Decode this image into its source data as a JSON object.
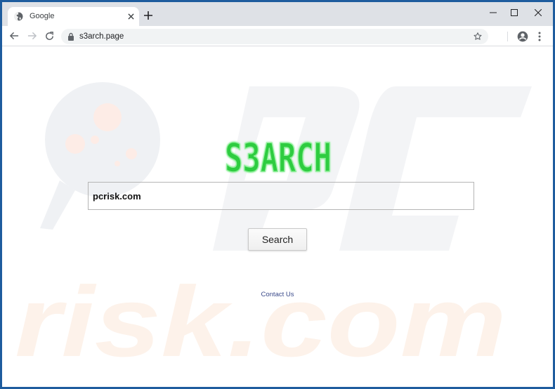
{
  "browser": {
    "tab": {
      "title": "Google",
      "favicon": "globe-icon",
      "close_icon": "close-icon"
    },
    "new_tab_icon": "plus-icon",
    "window_controls": [
      "minimize-icon",
      "maximize-icon",
      "close-icon"
    ],
    "toolbar": {
      "back_icon": "arrow-left-icon",
      "forward_icon": "arrow-right-icon",
      "reload_icon": "reload-icon",
      "lock_icon": "lock-icon",
      "url": "s3arch.page",
      "bookmark_icon": "star-icon",
      "profile_icon": "account-circle-icon",
      "menu_icon": "more-vertical-icon"
    }
  },
  "page": {
    "logo_text": "S3ARCH",
    "logo_color": "#2ecc40",
    "search_input_value": "pcrisk.com",
    "search_button_label": "Search",
    "contact_link_label": "Contact Us",
    "watermark_text": "risk.com"
  }
}
